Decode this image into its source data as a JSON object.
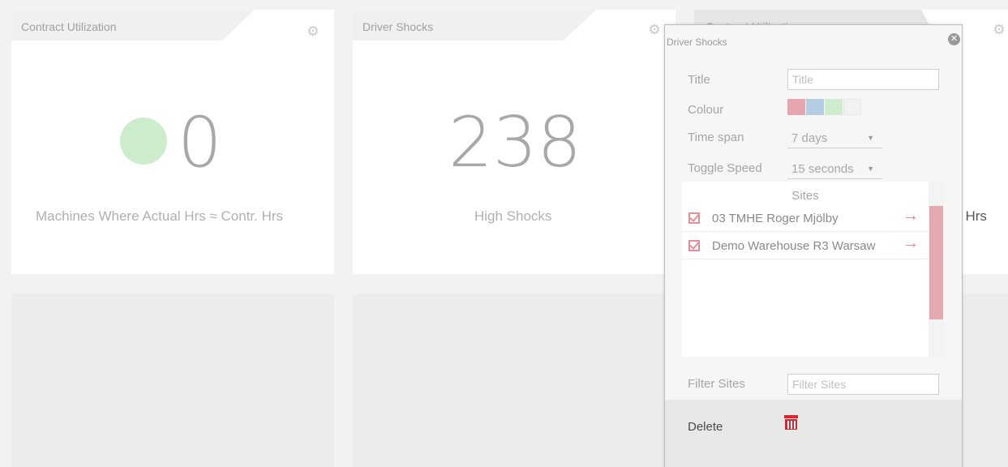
{
  "tiles": [
    {
      "title": "Contract Utilization",
      "value": "0",
      "subtitle": "Machines Where Actual Hrs ≈ Contr. Hrs",
      "status_color": "#cdeccc"
    },
    {
      "title": "Driver Shocks",
      "value": "238",
      "subtitle": "High Shocks"
    },
    {
      "title": "Contract Utilization",
      "subtitle_partial": ". Hrs"
    }
  ],
  "config_panel": {
    "header": "Driver Shocks",
    "close_icon": "close-icon",
    "title_label": "Title",
    "title_placeholder": "Title",
    "colour_label": "Colour",
    "colour_swatches": [
      "#e6a6ad",
      "#b5cde3",
      "#cfeccf",
      "#f1f1f1"
    ],
    "timespan_label": "Time span",
    "timespan_value": "7 days",
    "toggle_label": "Toggle Speed",
    "toggle_value": "15 seconds",
    "sites_header": "Sites",
    "sites": [
      {
        "name": "03 TMHE Roger Mjölby",
        "checked": true
      },
      {
        "name": "Demo Warehouse R3 Warsaw",
        "checked": true
      }
    ],
    "filter_label": "Filter Sites",
    "filter_placeholder": "Filter Sites",
    "delete_label": "Delete",
    "delete_icon": "trash-icon"
  },
  "colors": {
    "accent": "#e8808c",
    "delete_icon": "#d9262e"
  }
}
